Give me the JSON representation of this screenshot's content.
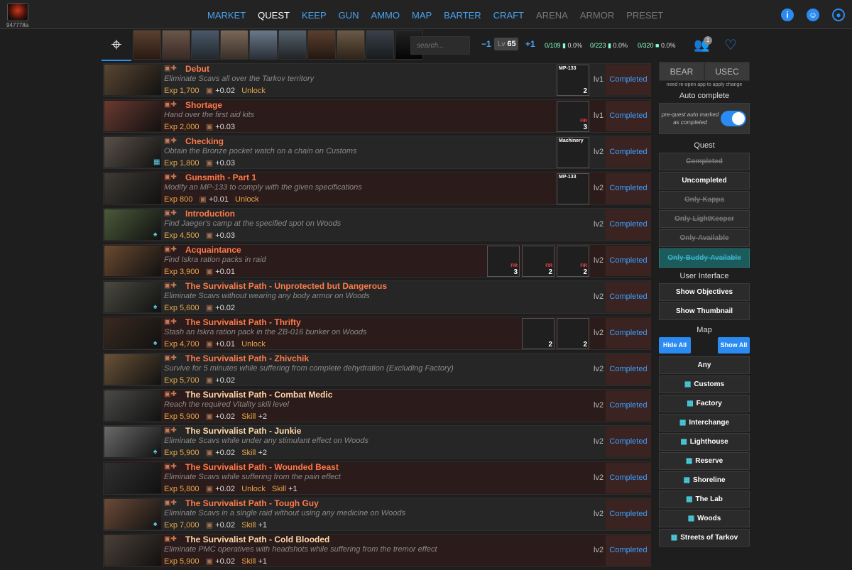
{
  "header": {
    "user_id": "947778a",
    "nav": [
      {
        "label": "MARKET",
        "state": "normal"
      },
      {
        "label": "QUEST",
        "state": "active"
      },
      {
        "label": "KEEP",
        "state": "normal"
      },
      {
        "label": "GUN",
        "state": "normal"
      },
      {
        "label": "AMMO",
        "state": "normal"
      },
      {
        "label": "MAP",
        "state": "normal"
      },
      {
        "label": "BARTER",
        "state": "normal"
      },
      {
        "label": "CRAFT",
        "state": "normal"
      },
      {
        "label": "ARENA",
        "state": "dim"
      },
      {
        "label": "ARMOR",
        "state": "dim"
      },
      {
        "label": "PRESET",
        "state": "dim"
      }
    ],
    "icons": [
      "info-icon",
      "discord-icon",
      "account-icon"
    ]
  },
  "toolbar": {
    "search_placeholder": "search...",
    "level_minus": "−1",
    "level_prefix": "Lv",
    "level": "65",
    "level_plus": "+1",
    "progress": [
      {
        "count": "0/109",
        "pct": "0.0%"
      },
      {
        "count": "0/223",
        "pct": "0.0%"
      },
      {
        "count": "0/320",
        "pct": "0.0%"
      }
    ],
    "badge_count": "1"
  },
  "quests": [
    {
      "title": "Debut",
      "desc": "Eliminate Scavs all over the Tarkov territory",
      "exp": "Exp 1,700",
      "rep": "+0.02",
      "extra": "Unlock",
      "extra_value": "",
      "lv": "lv1",
      "status": "Completed",
      "map_icon": "",
      "title_done": false,
      "items": [
        {
          "name": "MP-133",
          "count": "2",
          "fir": ""
        }
      ]
    },
    {
      "title": "Shortage",
      "desc": "Hand over the first aid kits",
      "exp": "Exp 2,000",
      "rep": "+0.03",
      "extra": "",
      "extra_value": "",
      "lv": "lv1",
      "status": "Completed",
      "map_icon": "",
      "title_done": false,
      "items": [
        {
          "name": "",
          "count": "3",
          "fir": "FIR"
        }
      ]
    },
    {
      "title": "Checking",
      "desc": "Obtain the Bronze pocket watch on a chain on Customs",
      "exp": "Exp 1,800",
      "rep": "+0.03",
      "extra": "",
      "extra_value": "",
      "lv": "lv2",
      "status": "Completed",
      "map_icon": "▦",
      "title_done": false,
      "items": [
        {
          "name": "Machinery",
          "count": "",
          "fir": ""
        }
      ]
    },
    {
      "title": "Gunsmith - Part 1",
      "desc": "Modify an MP-133 to comply with the given specifications",
      "exp": "Exp 800",
      "rep": "+0.01",
      "extra": "Unlock",
      "extra_value": "",
      "lv": "lv2",
      "status": "Completed",
      "map_icon": "",
      "title_done": false,
      "items": [
        {
          "name": "MP-133",
          "count": "",
          "fir": ""
        }
      ]
    },
    {
      "title": "Introduction",
      "desc": "Find Jaeger's camp at the specified spot on Woods",
      "exp": "Exp 4,500",
      "rep": "+0.03",
      "extra": "",
      "extra_value": "",
      "lv": "lv2",
      "status": "Completed",
      "map_icon": "♠",
      "title_done": false,
      "items": []
    },
    {
      "title": "Acquaintance",
      "desc": "Find Iskra ration packs in raid",
      "exp": "Exp 3,900",
      "rep": "+0.01",
      "extra": "",
      "extra_value": "",
      "lv": "lv2",
      "status": "Completed",
      "map_icon": "",
      "title_done": false,
      "items": [
        {
          "name": "",
          "count": "3",
          "fir": "FIR"
        },
        {
          "name": "",
          "count": "2",
          "fir": "FIR"
        },
        {
          "name": "",
          "count": "2",
          "fir": "FIR"
        }
      ]
    },
    {
      "title": "The Survivalist Path - Unprotected but Dangerous",
      "desc": "Eliminate Scavs without wearing any body armor on Woods",
      "exp": "Exp 5,600",
      "rep": "+0.02",
      "extra": "",
      "extra_value": "",
      "lv": "lv2",
      "status": "Completed",
      "map_icon": "♠",
      "title_done": false,
      "items": []
    },
    {
      "title": "The Survivalist Path - Thrifty",
      "desc": "Stash an Iskra ration pack in the ZB-016 bunker on Woods",
      "exp": "Exp 4,700",
      "rep": "+0.01",
      "extra": "Unlock",
      "extra_value": "",
      "lv": "lv2",
      "status": "Completed",
      "map_icon": "♠",
      "title_done": false,
      "items": [
        {
          "name": "",
          "count": "2",
          "fir": ""
        },
        {
          "name": "",
          "count": "2",
          "fir": ""
        }
      ]
    },
    {
      "title": "The Survivalist Path - Zhivchik",
      "desc": "Survive for 5 minutes while suffering from complete dehydration (Excluding Factory)",
      "exp": "Exp 5,700",
      "rep": "+0.02",
      "extra": "",
      "extra_value": "",
      "lv": "lv2",
      "status": "Completed",
      "map_icon": "",
      "title_done": false,
      "items": []
    },
    {
      "title": "The Survivalist Path - Combat Medic",
      "desc": "Reach the required Vitality skill level",
      "exp": "Exp 5,900",
      "rep": "+0.02",
      "extra": "Skill",
      "extra_value": "+2",
      "lv": "lv2",
      "status": "Completed",
      "map_icon": "",
      "title_done": true,
      "items": []
    },
    {
      "title": "The Survivalist Path - Junkie",
      "desc": "Eliminate Scavs while under any stimulant effect on Woods",
      "exp": "Exp 5,900",
      "rep": "+0.02",
      "extra": "Skill",
      "extra_value": "+2",
      "lv": "lv2",
      "status": "Completed",
      "map_icon": "♠",
      "title_done": true,
      "items": []
    },
    {
      "title": "The Survivalist Path - Wounded Beast",
      "desc": "Eliminate Scavs while suffering from the pain effect",
      "exp": "Exp 5,800",
      "rep": "+0.02",
      "extra": "Unlock",
      "extra_value": "Skill",
      "extra2": "+1",
      "lv": "lv2",
      "status": "Completed",
      "map_icon": "",
      "title_done": false,
      "items": []
    },
    {
      "title": "The Survivalist Path - Tough Guy",
      "desc": "Eliminate Scavs in a single raid without using any medicine on Woods",
      "exp": "Exp 7,000",
      "rep": "+0.02",
      "extra": "Skill",
      "extra_value": "+1",
      "lv": "lv2",
      "status": "Completed",
      "map_icon": "♠",
      "title_done": false,
      "items": []
    },
    {
      "title": "The Survivalist Path - Cold Blooded",
      "desc": "Eliminate PMC operatives with headshots while suffering from the tremor effect",
      "exp": "Exp 5,900",
      "rep": "+0.02",
      "extra": "Skill",
      "extra_value": "+1",
      "lv": "lv2",
      "status": "Completed",
      "map_icon": "",
      "title_done": true,
      "items": []
    }
  ],
  "panel": {
    "factions": [
      "BEAR",
      "USEC"
    ],
    "faction_note": "need re-open app to apply change",
    "auto_complete_title": "Auto complete",
    "auto_complete_desc": "pre-quest auto marked as completed",
    "quest_title": "Quest",
    "quest_filters": [
      {
        "label": "Completed",
        "state": "off"
      },
      {
        "label": "Uncompleted",
        "state": "on"
      },
      {
        "label": "Only-Kappa",
        "state": "off"
      },
      {
        "label": "Only-LightKeeper",
        "state": "off"
      },
      {
        "label": "Only-Available",
        "state": "off"
      },
      {
        "label": "Only-Buddy-Available",
        "state": "buddy"
      }
    ],
    "ui_title": "User Interface",
    "ui_buttons": [
      "Show Objectives",
      "Show Thumbnail"
    ],
    "map_title": "Map",
    "hide_all": "Hide All",
    "show_all": "Show All",
    "maps": [
      "Any",
      "Customs",
      "Factory",
      "Interchange",
      "Lighthouse",
      "Reserve",
      "Shoreline",
      "The Lab",
      "Woods",
      "Streets of Tarkov"
    ]
  }
}
